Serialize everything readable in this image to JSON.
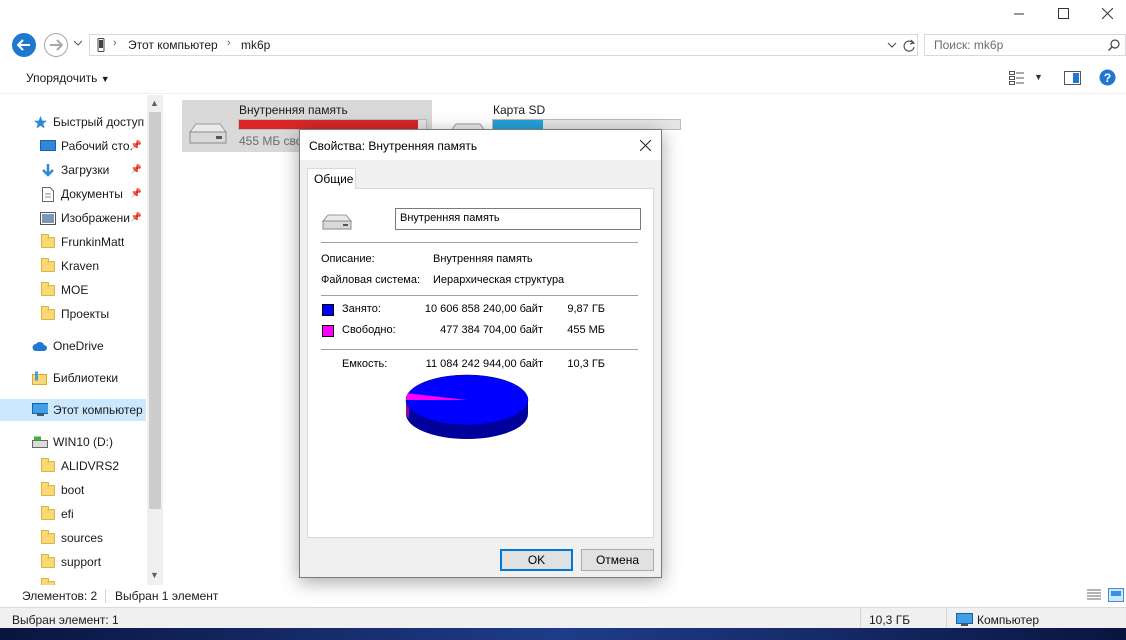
{
  "window": {
    "controls": [
      "minimize-icon",
      "maximize-icon",
      "close-icon"
    ]
  },
  "address": {
    "crumbs": [
      "Этот компьютер",
      "mk6p"
    ],
    "search_placeholder": "Поиск: mk6p"
  },
  "toolbar": {
    "organize_label": "Упорядочить"
  },
  "nav": {
    "quick_access": "Быстрый доступ",
    "items": [
      {
        "label": "Рабочий сто.",
        "icon": "desktop-icon",
        "pinned": true
      },
      {
        "label": "Загрузки",
        "icon": "download-icon",
        "pinned": true
      },
      {
        "label": "Документы",
        "icon": "documents-icon",
        "pinned": true
      },
      {
        "label": "Изображени",
        "icon": "pictures-icon",
        "pinned": true
      },
      {
        "label": "FrunkinMatt",
        "icon": "folder-icon"
      },
      {
        "label": "Kraven",
        "icon": "folder-icon"
      },
      {
        "label": "MOE",
        "icon": "folder-icon"
      },
      {
        "label": "Проекты",
        "icon": "folder-icon"
      }
    ],
    "onedrive": "OneDrive",
    "libraries": "Библиотеки",
    "this_pc": "Этот компьютер",
    "drive": "WIN10 (D:)",
    "drive_folders": [
      "ALIDVRS2",
      "boot",
      "efi",
      "sources",
      "support"
    ]
  },
  "drives": [
    {
      "name": "Внутренняя память",
      "free_text": "455 МБ сво",
      "used_fraction": 0.957,
      "bar_color": "#da2626"
    },
    {
      "name": "Карта SD",
      "used_fraction": 0.27,
      "bar_color": "#26a0da"
    }
  ],
  "status": {
    "count": "Элементов: 2",
    "selection": "Выбран 1 элемент",
    "bottom_selected": "Выбран элемент: 1",
    "size": "10,3 ГБ",
    "location": "Компьютер"
  },
  "dialog": {
    "title": "Свойства: Внутренняя память",
    "tab": "Общие",
    "name_value": "Внутренняя память",
    "description_label": "Описание:",
    "description_value": "Внутренняя память",
    "fs_label": "Файловая система:",
    "fs_value": "Иерархическая структура",
    "used_label": "Занято:",
    "used_bytes": "10 606 858 240,00 байт",
    "used_short": "9,87 ГБ",
    "free_label": "Свободно:",
    "free_bytes": "477 384 704,00 байт",
    "free_short": "455 МБ",
    "capacity_label": "Емкость:",
    "capacity_bytes": "11 084 242 944,00 байт",
    "capacity_short": "10,3 ГБ",
    "used_color": "#0000ff",
    "free_color": "#ff00ff",
    "ok": "OK",
    "cancel": "Отмена"
  }
}
